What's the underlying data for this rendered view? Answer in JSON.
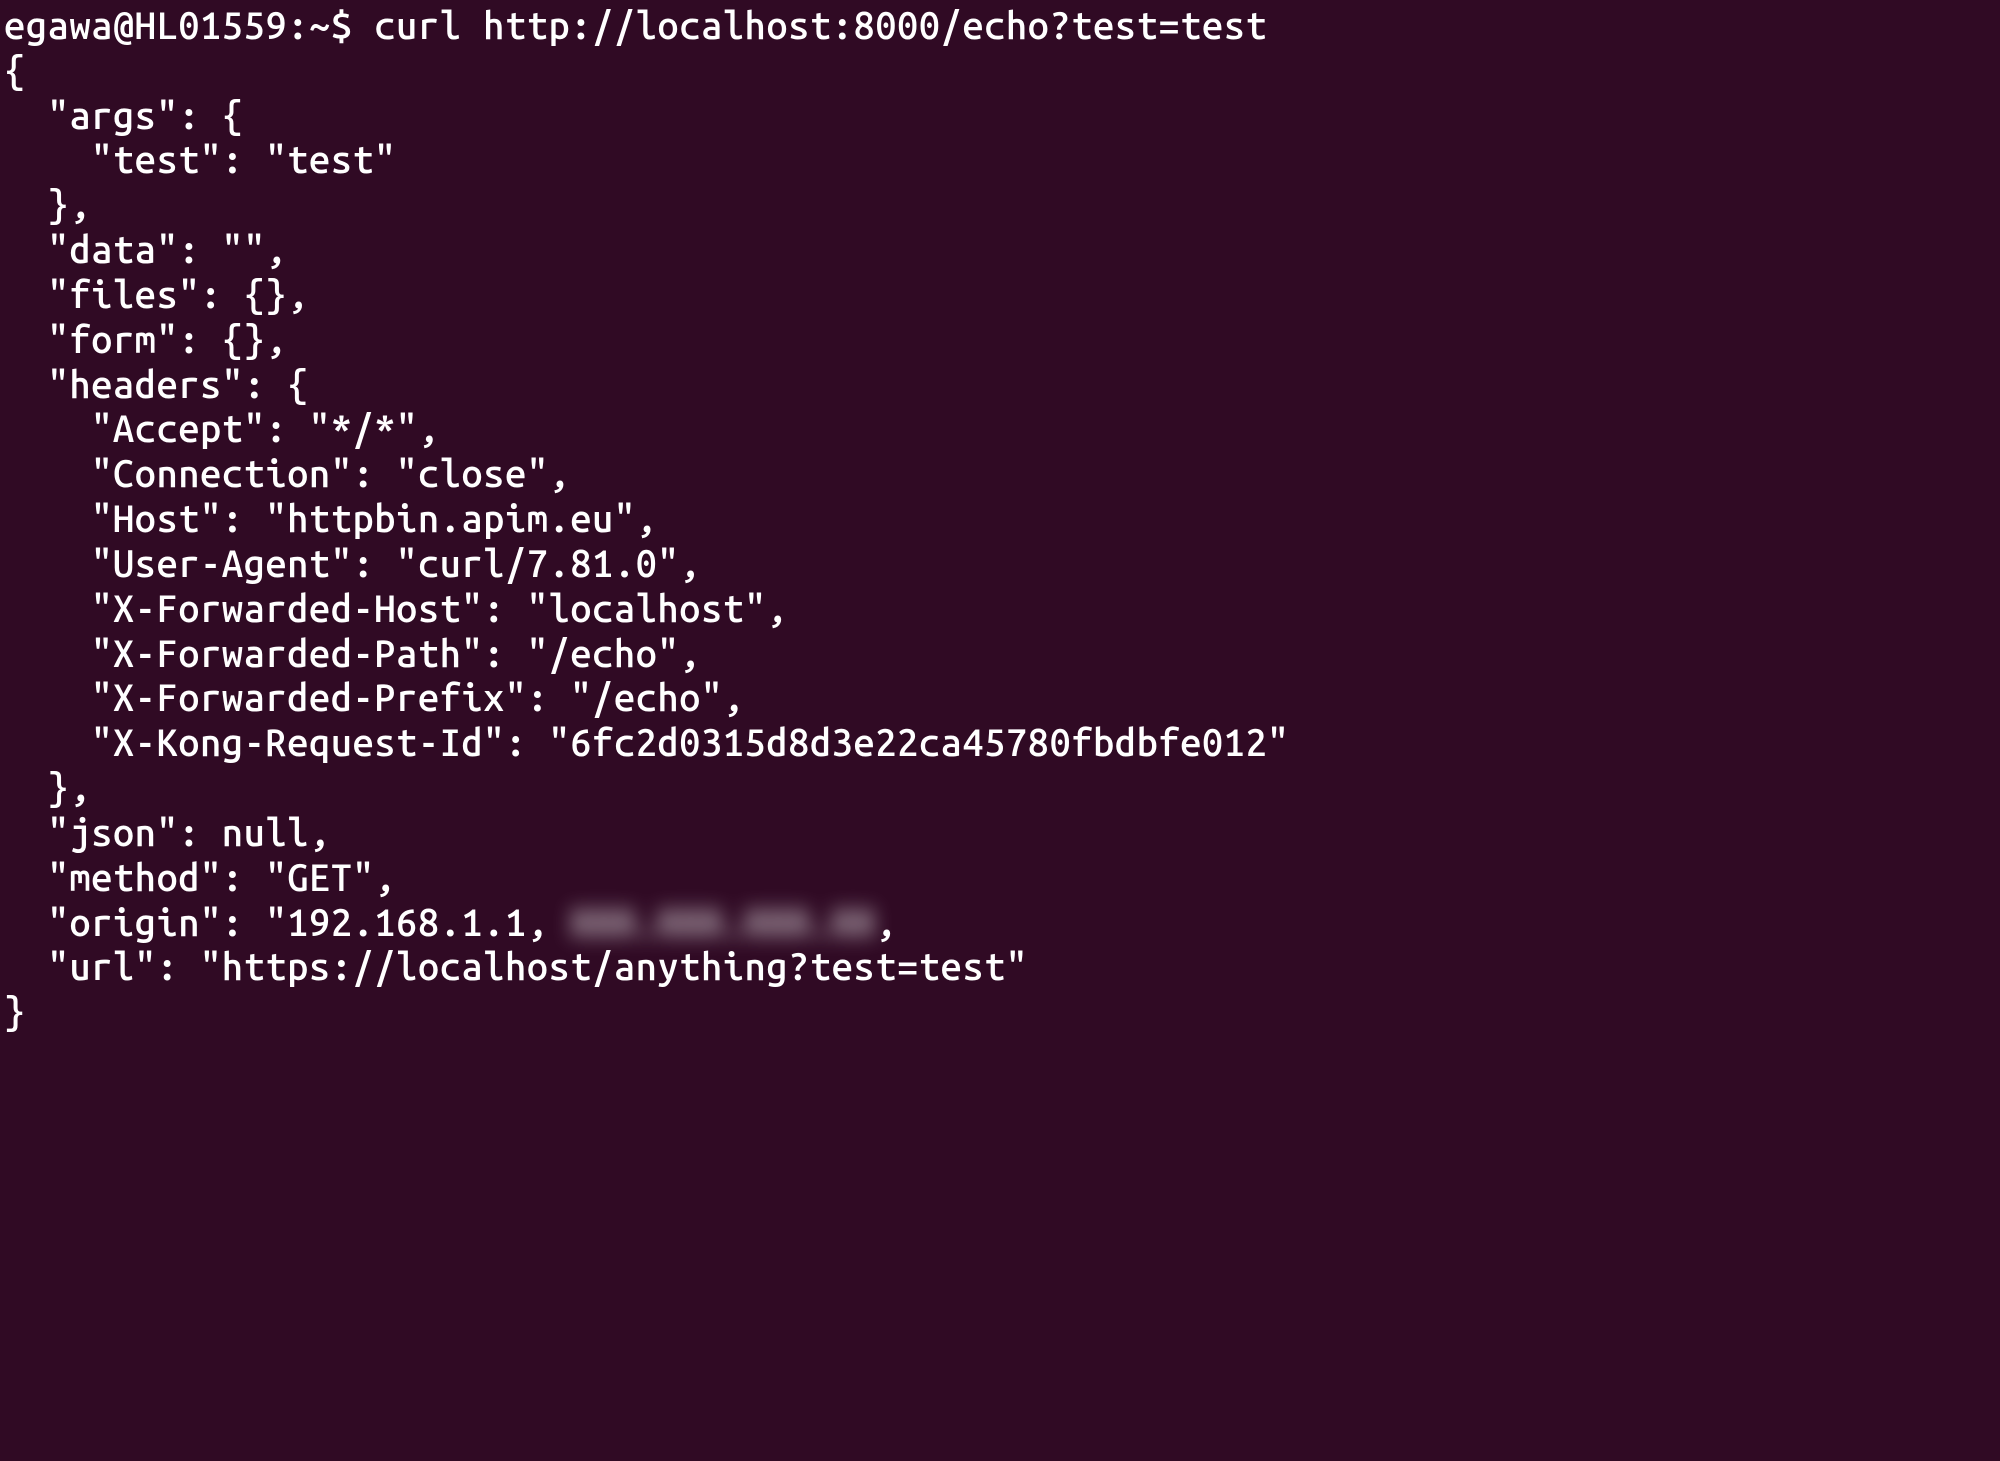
{
  "prompt": {
    "user_host": "egawa@HL01559",
    "cwd": "~",
    "symbol": "$"
  },
  "command": "curl http://localhost:8000/echo?test=test",
  "output_lines": {
    "l0": "{",
    "l1": "  \"args\": {",
    "l2": "    \"test\": \"test\"",
    "l3": "  },",
    "l4": "  \"data\": \"\",",
    "l5": "  \"files\": {},",
    "l6": "  \"form\": {},",
    "l7": "  \"headers\": {",
    "l8": "    \"Accept\": \"*/*\",",
    "l9": "    \"Connection\": \"close\",",
    "l10": "    \"Host\": \"httpbin.apim.eu\",",
    "l11": "    \"User-Agent\": \"curl/7.81.0\",",
    "l12": "    \"X-Forwarded-Host\": \"localhost\",",
    "l13": "    \"X-Forwarded-Path\": \"/echo\",",
    "l14": "    \"X-Forwarded-Prefix\": \"/echo\",",
    "l15": "    \"X-Kong-Request-Id\": \"6fc2d0315d8d3e22ca45780fbdbfe012\"",
    "l16": "  },",
    "l17": "  \"json\": null,",
    "l18": "  \"method\": \"GET\",",
    "origin_prefix": "  \"origin\": \"192.168.1.1, ",
    "origin_blur": "XXX.XXX.XXX.XX",
    "origin_suffix": ",",
    "l20": "  \"url\": \"https://localhost/anything?test=test\"",
    "l21": "}"
  }
}
